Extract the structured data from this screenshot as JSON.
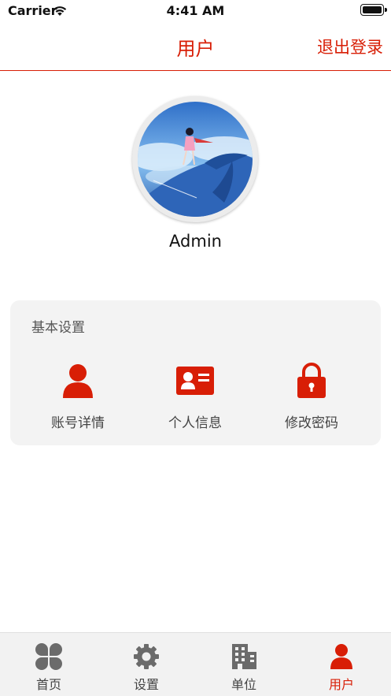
{
  "status_bar": {
    "carrier": "Carrier",
    "time": "4:41 AM"
  },
  "header": {
    "title": "用户",
    "logout_label": "退出登录"
  },
  "profile": {
    "username": "Admin"
  },
  "settings_section": {
    "title": "基本设置",
    "items": [
      {
        "label": "账号详情",
        "icon": "user-icon"
      },
      {
        "label": "个人信息",
        "icon": "id-card-icon"
      },
      {
        "label": "修改密码",
        "icon": "lock-icon"
      }
    ]
  },
  "tab_bar": {
    "tabs": [
      {
        "label": "首页",
        "icon": "clover-icon"
      },
      {
        "label": "设置",
        "icon": "gear-icon"
      },
      {
        "label": "单位",
        "icon": "building-icon"
      },
      {
        "label": "用户",
        "icon": "user-icon"
      }
    ],
    "active_tab": "用户"
  },
  "colors": {
    "accent": "#d81e06",
    "icon_gray": "#6b6b6b",
    "card_bg": "#f3f3f3"
  }
}
